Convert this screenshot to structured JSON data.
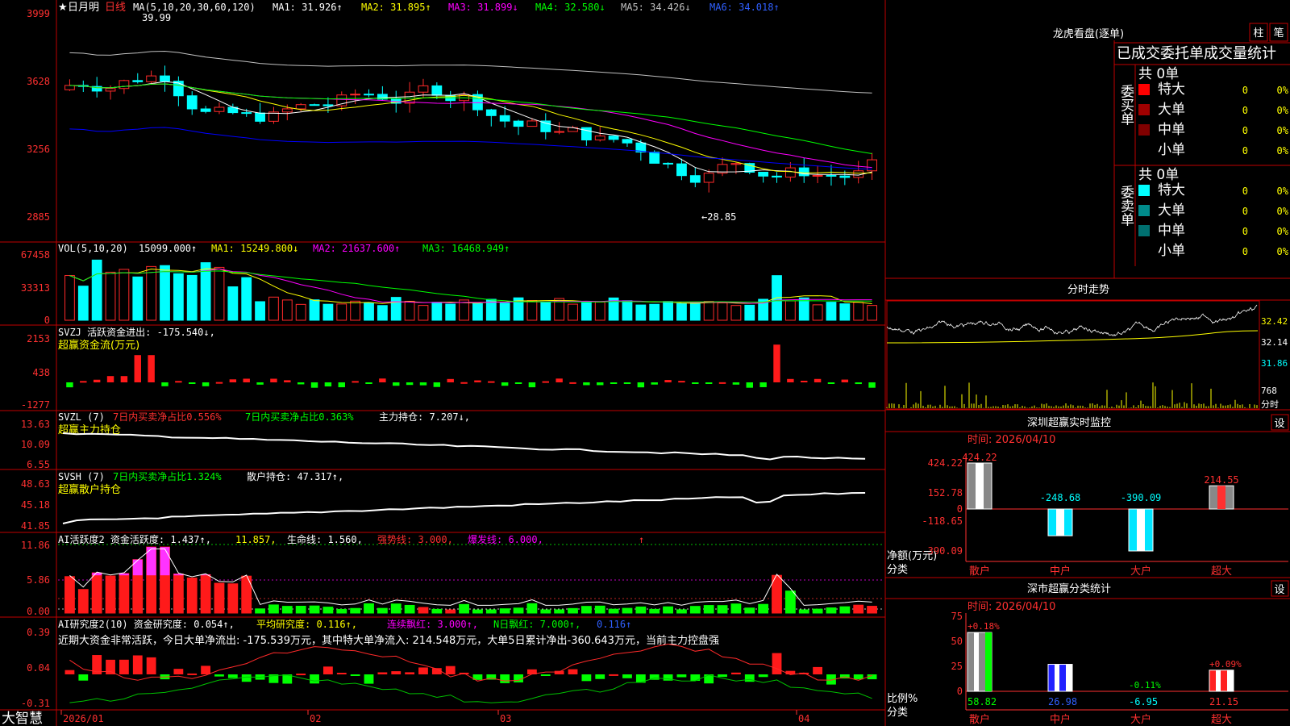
{
  "app": {
    "name": "大智慧",
    "stock": "日月明",
    "period": "日线"
  },
  "colors": {
    "up": "#ff2a2a",
    "down": "#00ffff",
    "ma1": "#ffffff",
    "ma2": "#ffff00",
    "ma3": "#ff00ff",
    "ma4": "#00ff00",
    "ma5": "#c0c0c0",
    "ma6": "#0000ff",
    "grid": "#a00000",
    "text_yellow": "#ffff00",
    "text_green": "#00ff00",
    "text_magenta": "#ff00ff"
  },
  "main_panel": {
    "star": "★",
    "ma_title": "MA(5,10,20,30,60,120)",
    "ma1": "MA1: 31.926↑",
    "ma2": "MA2: 31.895↑",
    "ma3": "MA3: 31.899↓",
    "ma4": "MA4: 32.580↓",
    "ma5": "MA5: 34.426↓",
    "ma6": "MA6: 34.018↑",
    "y_ticks": [
      "3999",
      "3628",
      "3256",
      "2885"
    ],
    "high_label": "39.99",
    "low_label": "←28.85"
  },
  "vol_panel": {
    "title": "VOL(5,10,20)",
    "value": "15099.000↑",
    "ma1": "MA1: 15249.800↓",
    "ma2": "MA2: 21637.600↑",
    "ma3": "MA3: 16468.949↑",
    "y_ticks": [
      "67458",
      "33313",
      "0"
    ]
  },
  "svzj_panel": {
    "title": "SVZJ  活跃资金进出: -175.540↓,",
    "subtitle": "超赢资金流(万元)",
    "y_ticks": [
      "2153",
      "438",
      "-1277"
    ]
  },
  "svzl_panel": {
    "p1": "SVZL (7)",
    "p2": "7日内买卖净占比0.556%",
    "p3": "7日内买卖净占比0.363%",
    "p4": "主力持仓: 7.207↓,",
    "subtitle": "超赢主力持仓",
    "y_ticks": [
      "13.63",
      "10.09",
      "6.55"
    ]
  },
  "svsh_panel": {
    "p1": "SVSH (7)",
    "p2": "7日内买卖净占比1.324%",
    "p3": "散户持仓: 47.317↑,",
    "subtitle": "超赢散户持仓",
    "y_ticks": [
      "48.63",
      "45.18",
      "41.85"
    ]
  },
  "ai1_panel": {
    "p1": "AI活跃度2 资金活跃度: 1.437↑,",
    "p2": "11.857,",
    "p3": "生命线: 1.560,",
    "p4": "强势线: 3.000,",
    "p5": "爆发线: 6.000,",
    "p6": "↑",
    "y_ticks": [
      "11.86",
      "5.86",
      "0.00"
    ]
  },
  "ai2_panel": {
    "p1": "AI研究度2(10) 资金研究度: 0.054↑,",
    "p2": "平均研究度: 0.116↑,",
    "p3": "连续飘红: 3.000↑,",
    "p4": "N日飘红: 7.000↑,",
    "p5": "0.116↑",
    "summary": "近期大资金非常活跃，今日大单净流出: -175.539万元，其中特大单净流入: 214.548万元，大单5日累计净出-360.643万元，当前主力控盘强",
    "y_ticks": [
      "0.39",
      "0.04",
      "-0.31"
    ]
  },
  "x_axis": [
    "2026/01",
    "02",
    "03",
    "04"
  ],
  "right_panel": {
    "lhb_title": "龙虎看盘(逐单)",
    "btn_bar": "柱",
    "btn_pen": "笔",
    "stats_header": "已成交委托单成交量统计",
    "buy_label": "委买单",
    "sell_label": "委卖单",
    "buy_total": "共 0单",
    "sell_total": "共 0单",
    "buy_rows": [
      {
        "name": "特大",
        "count": "0",
        "pct": "0%",
        "color": "#ff0000"
      },
      {
        "name": "大单",
        "count": "0",
        "pct": "0%",
        "color": "#a00000"
      },
      {
        "name": "中单",
        "count": "0",
        "pct": "0%",
        "color": "#800000"
      },
      {
        "name": "小单",
        "count": "0",
        "pct": "0%",
        "color": "#000000"
      }
    ],
    "sell_rows": [
      {
        "name": "特大",
        "count": "0",
        "pct": "0%",
        "color": "#00ffff"
      },
      {
        "name": "大单",
        "count": "0",
        "pct": "0%",
        "color": "#008b8b"
      },
      {
        "name": "中单",
        "count": "0",
        "pct": "0%",
        "color": "#007070"
      },
      {
        "name": "小单",
        "count": "0",
        "pct": "0%",
        "color": "#000000"
      }
    ],
    "intraday_title": "分时走势",
    "intraday_ticks": [
      "32.42",
      "32.14",
      "31.86"
    ],
    "intraday_vol": "768",
    "intraday_vol_label": "分时",
    "monitor_title": "深圳超赢实时监控",
    "monitor_btn": "设",
    "monitor_time": "时间: 2026/04/10",
    "monitor_ticks": [
      "424.22",
      "152.78",
      "0",
      "-118.65",
      "-390.09"
    ],
    "monitor_axis1": "净额(万元)",
    "monitor_axis2": "分类",
    "monitor_cats": [
      "散户",
      "中户",
      "大户",
      "超大"
    ],
    "monitor_values": [
      424.22,
      -248.68,
      -390.09,
      214.55
    ],
    "monitor_value_labels": [
      "424.22",
      "-248.68",
      "-390.09",
      "214.55"
    ],
    "class_title": "深市超赢分类统计",
    "class_btn": "设",
    "class_time": "时间: 2026/04/10",
    "class_ticks": [
      "75",
      "50",
      "25",
      "0"
    ],
    "class_axis1": "比例%",
    "class_axis2": "分类",
    "class_cats": [
      "散户",
      "中户",
      "大户",
      "超大"
    ],
    "class_values": [
      58.82,
      26.98,
      -6.95,
      21.15
    ],
    "class_value_labels": [
      "58.82",
      "26.98",
      "-6.95",
      "21.15"
    ],
    "class_deltas": [
      "+0.18%",
      "",
      "-0.11%",
      "+0.09%"
    ]
  }
}
